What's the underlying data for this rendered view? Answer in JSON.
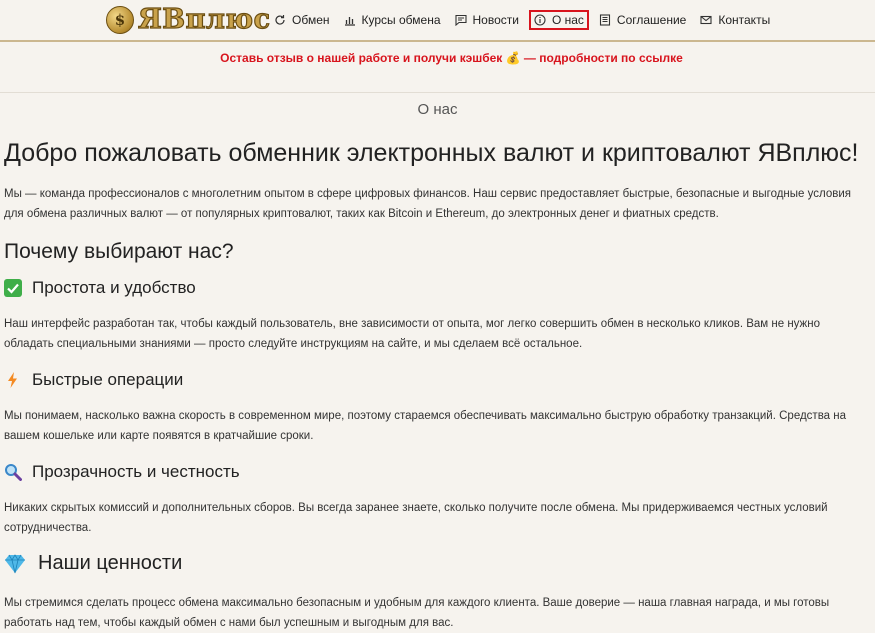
{
  "header": {
    "logo_text": "ЯВплюс",
    "logo_symbol": "$",
    "nav": [
      {
        "label": "Обмен",
        "icon": "refresh-icon"
      },
      {
        "label": "Курсы обмена",
        "icon": "bar-chart-icon"
      },
      {
        "label": "Новости",
        "icon": "message-icon"
      },
      {
        "label": "О нас",
        "icon": "info-icon",
        "active": true
      },
      {
        "label": "Соглашение",
        "icon": "book-icon"
      },
      {
        "label": "Контакты",
        "icon": "mail-icon"
      }
    ]
  },
  "promo": {
    "text": "Оставь отзыв о нашей работе и получи кэшбек 💰 — подробности по ссылке"
  },
  "page_heading": "О нас",
  "main": {
    "title": "Добро пожаловать обменник электронных валют и криптовалют ЯВплюс!",
    "intro": "Мы — команда профессионалов с многолетним опытом в сфере цифровых финансов. Наш сервис предоставляет быстрые, безопасные и выгодные условия для обмена различных валют — от популярных криптовалют, таких как Bitcoin и Ethereum, до электронных денег и фиатных средств.",
    "why_title": "Почему выбирают нас?",
    "sections": [
      {
        "icon": "check-icon",
        "title": "Простота и удобство",
        "text": "Наш интерфейс разработан так, чтобы каждый пользователь, вне зависимости от опыта, мог легко совершить обмен в несколько кликов. Вам не нужно обладать специальными знаниями — просто следуйте инструкциям на сайте, и мы сделаем всё остальное."
      },
      {
        "icon": "lightning-icon",
        "title": "Быстрые операции",
        "text": "Мы понимаем, насколько важна скорость в современном мире, поэтому стараемся обеспечивать максимально быструю обработку транзакций. Средства на вашем кошельке или карте появятся в кратчайшие сроки."
      },
      {
        "icon": "magnifier-icon",
        "title": "Прозрачность и честность",
        "text": "Никаких скрытых комиссий и дополнительных сборов. Вы всегда заранее знаете, сколько получите после обмена. Мы придерживаемся честных условий сотрудничества."
      }
    ],
    "values": {
      "icon": "gem-icon",
      "title": "Наши ценности",
      "text": "Мы стремимся сделать процесс обмена максимально безопасным и удобным для каждого клиента. Ваше доверие — наша главная награда, и мы готовы работать над тем, чтобы каждый обмен с нами был успешным и выгодным для вас."
    }
  }
}
